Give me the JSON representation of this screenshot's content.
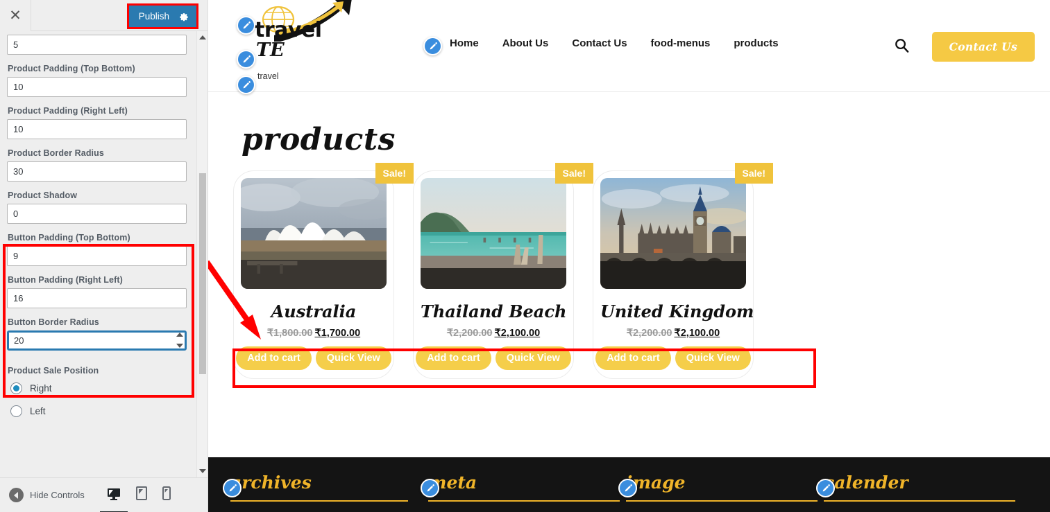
{
  "customizer": {
    "close_icon": "close-icon",
    "publish_label": "Publish",
    "gear_icon": "gear-icon",
    "fields": [
      {
        "label": "",
        "value": "5",
        "name": "product-margin-input"
      },
      {
        "label": "Product Padding (Top Bottom)",
        "value": "10",
        "name": "product-padding-top-bottom-input"
      },
      {
        "label": "Product Padding (Right Left)",
        "value": "10",
        "name": "product-padding-right-left-input"
      },
      {
        "label": "Product Border Radius",
        "value": "30",
        "name": "product-border-radius-input"
      },
      {
        "label": "Product Shadow",
        "value": "0",
        "name": "product-shadow-input"
      },
      {
        "label": "Button Padding (Top Bottom)",
        "value": "9",
        "name": "button-padding-top-bottom-input"
      },
      {
        "label": "Button Padding (Right Left)",
        "value": "16",
        "name": "button-padding-right-left-input"
      },
      {
        "label": "Button Border Radius",
        "value": "20",
        "name": "button-border-radius-input"
      }
    ],
    "sale_position": {
      "label": "Product Sale Position",
      "options": [
        {
          "label": "Right",
          "selected": true
        },
        {
          "label": "Left",
          "selected": false
        }
      ]
    },
    "footer": {
      "hide_controls_label": "Hide Controls",
      "devices": [
        "desktop-icon",
        "tablet-icon",
        "mobile-icon"
      ],
      "active_device": "desktop-icon"
    },
    "accent_color": "#2a7ab0",
    "highlight_color": "#ff0000"
  },
  "site": {
    "logo": {
      "text": "travel",
      "sub": "TE",
      "tagline": "travel"
    },
    "nav": [
      {
        "label": "Home"
      },
      {
        "label": "About Us"
      },
      {
        "label": "Contact Us"
      },
      {
        "label": "food-menus"
      },
      {
        "label": "products"
      }
    ],
    "search_icon": "search-icon",
    "cta_label": "Contact Us",
    "cta_color": "#f5c944",
    "page_title": "products",
    "products": [
      {
        "badge": "Sale!",
        "title": "Australia",
        "price_old": "₹1,800.00",
        "price_new": "₹1,700.00",
        "add_label": "Add to cart",
        "quick_label": "Quick View",
        "image": "sydney-opera-house-photo"
      },
      {
        "badge": "Sale!",
        "title": "Thailand Beach",
        "price_old": "₹2,200.00",
        "price_new": "₹2,100.00",
        "add_label": "Add to cart",
        "quick_label": "Quick View",
        "image": "thailand-beach-photo"
      },
      {
        "badge": "Sale!",
        "title": "United Kingdom",
        "price_old": "₹2,200.00",
        "price_new": "₹2,100.00",
        "add_label": "Add to cart",
        "quick_label": "Quick View",
        "image": "big-ben-london-photo"
      }
    ],
    "footer_widgets": [
      {
        "label": "archives"
      },
      {
        "label": "meta"
      },
      {
        "label": "image"
      },
      {
        "label": "calender"
      }
    ],
    "footer_bg": "#141414",
    "footer_accent": "#f0b429"
  }
}
